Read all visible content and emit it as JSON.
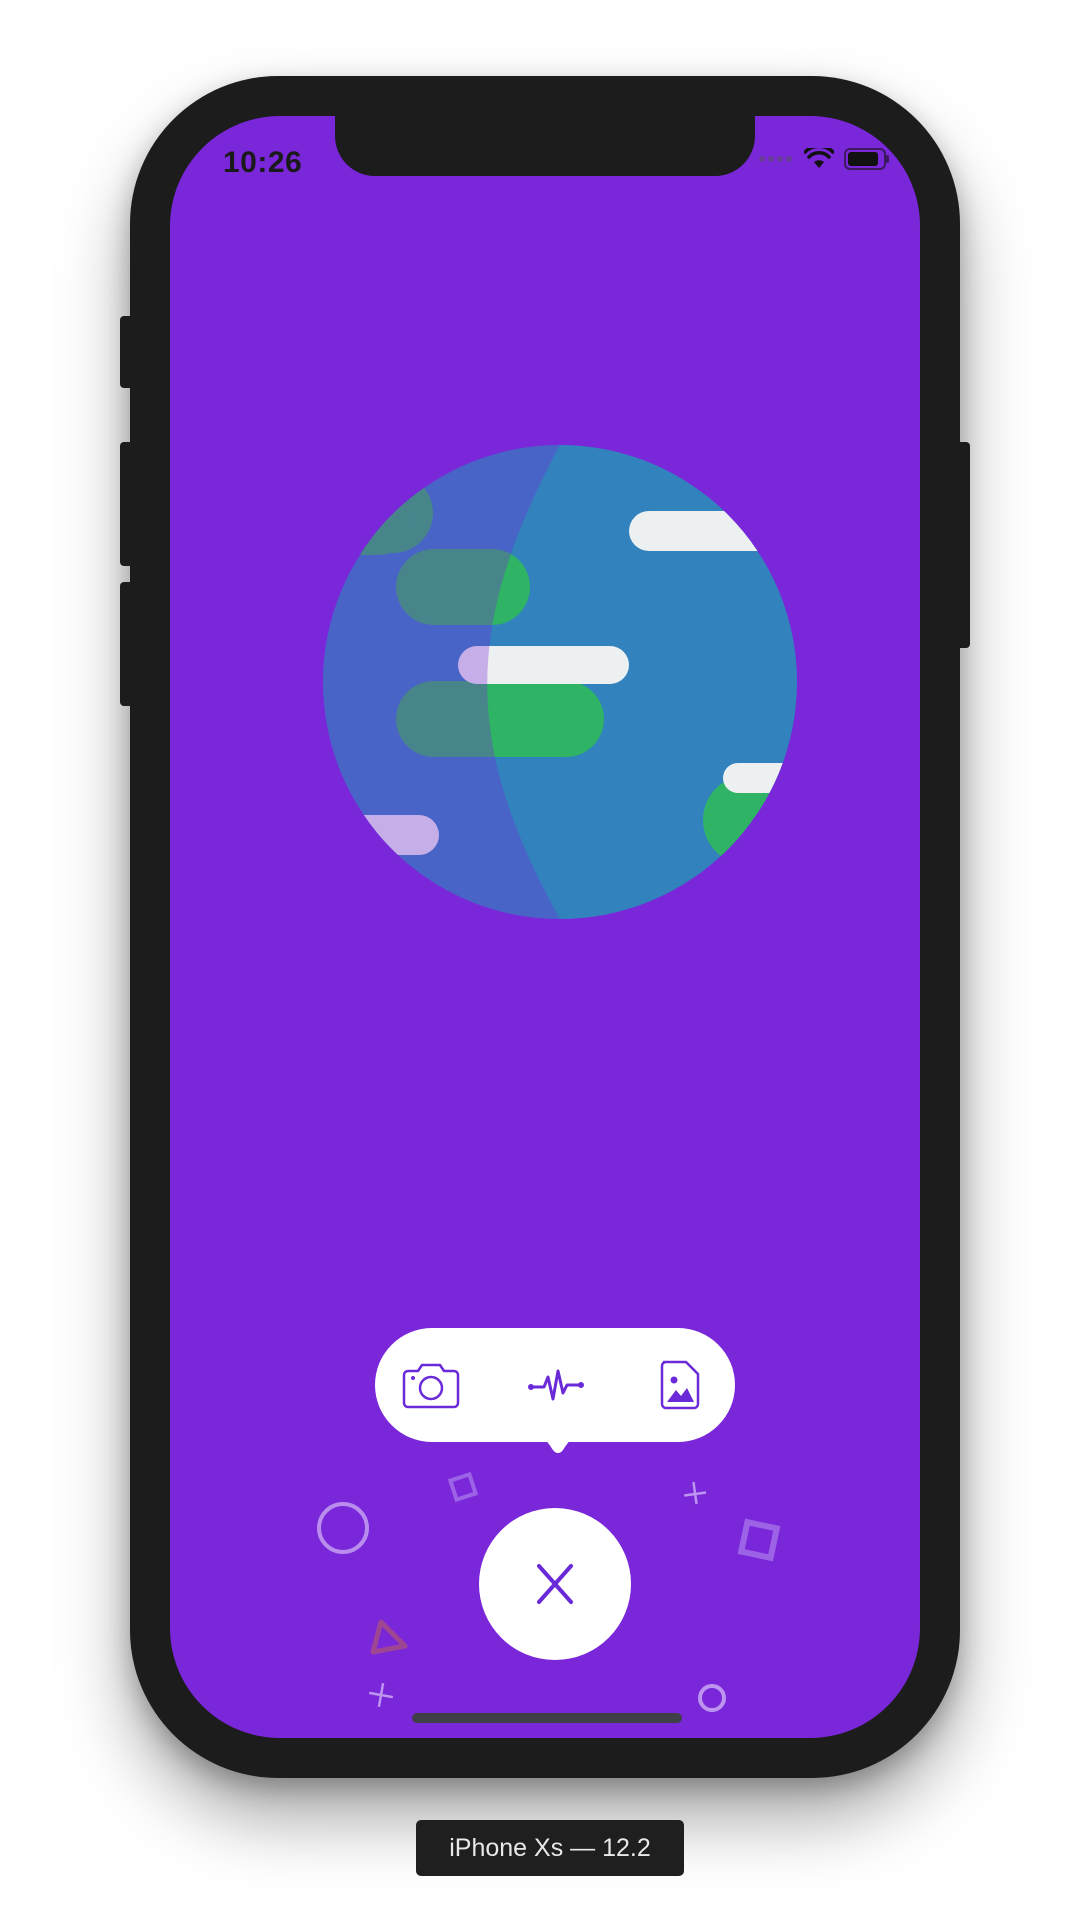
{
  "status_bar": {
    "time": "10:26",
    "icons": [
      "signal-dots-icon",
      "wifi-icon",
      "battery-icon"
    ]
  },
  "illustration": {
    "name": "globe-illustration"
  },
  "action_menu": {
    "items": [
      {
        "icon": "camera-icon"
      },
      {
        "icon": "activity-waveform-icon"
      },
      {
        "icon": "image-file-icon"
      }
    ]
  },
  "fab": {
    "icon": "close-icon"
  },
  "simulator": {
    "device_label": "iPhone Xs — 12.2"
  },
  "colors": {
    "background": "#7a27da",
    "accent": "#6a2ad8",
    "ocean": "#3182bd",
    "land": "#2fb364",
    "cloud": "#ecf0f1",
    "pill": "#ffffff"
  }
}
